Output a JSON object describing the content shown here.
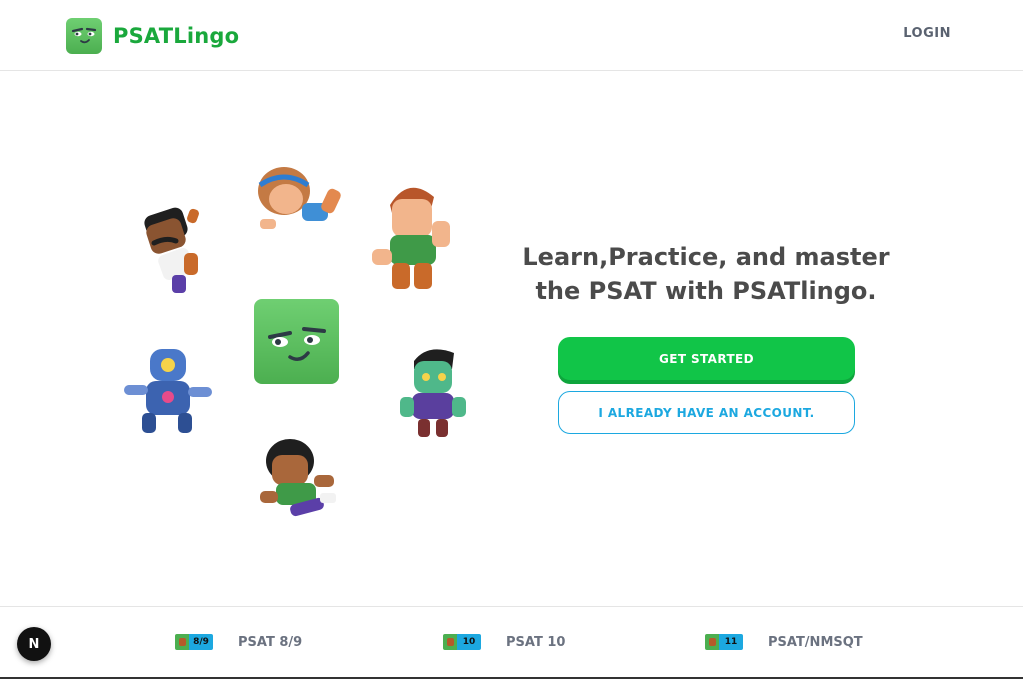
{
  "header": {
    "brand_name": "PSATLingo",
    "login_label": "LOGIN"
  },
  "hero": {
    "headline": "Learn,Practice, and master the PSAT with PSATlingo.",
    "get_started_label": "GET STARTED",
    "have_account_label": "I ALREADY HAVE AN ACCOUNT."
  },
  "footer": {
    "items": [
      {
        "badge": "8/9",
        "label": "PSAT 8/9"
      },
      {
        "badge": "10",
        "label": "PSAT 10"
      },
      {
        "badge": "11",
        "label": "PSAT/NMSQT"
      }
    ]
  },
  "dev_badge": {
    "letter": "N"
  },
  "colors": {
    "brand_green": "#1aa83c",
    "primary_button": "#11c548",
    "secondary_accent": "#1ca8e0",
    "text": "#4b4b4b"
  }
}
